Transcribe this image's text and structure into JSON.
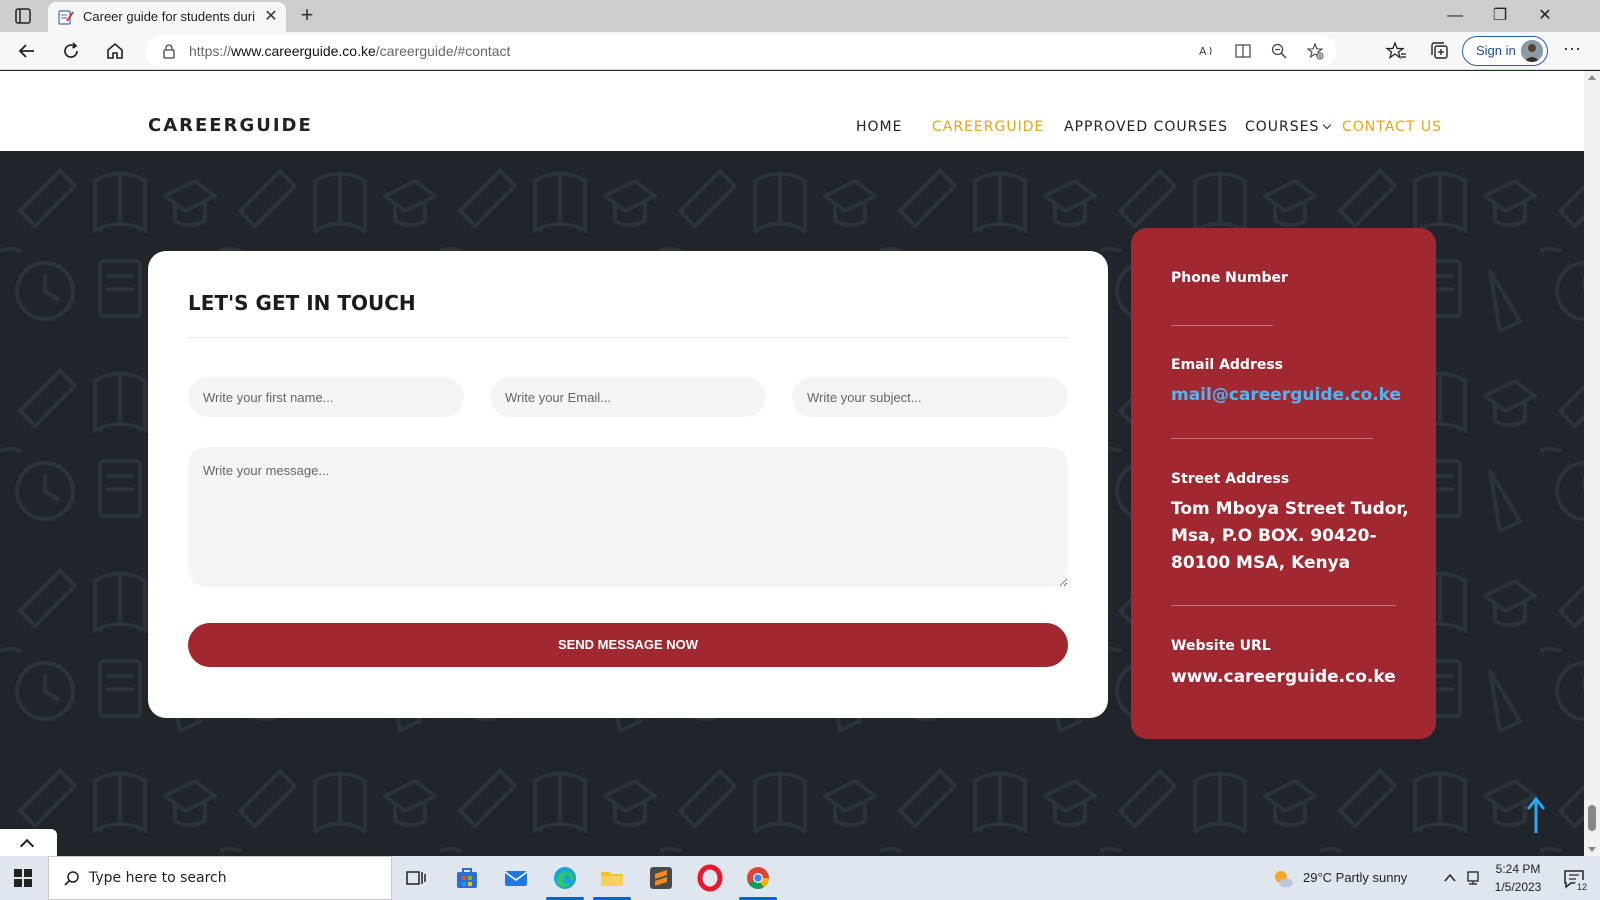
{
  "browser": {
    "tab_title": "Career guide for students during",
    "new_tab_symbol": "+",
    "tab_close_symbol": "✕",
    "url_prefix": "https://",
    "url_host": "www.careerguide.co.ke",
    "url_path": "/careerguide/#contact",
    "sign_in_label": "Sign in",
    "more_symbol": "⋯",
    "window_controls": {
      "minimize": "—",
      "maximize": "❐",
      "close": "✕"
    },
    "icons": [
      "tab-actions-icon",
      "back-icon",
      "refresh-icon",
      "home-icon",
      "lock-icon",
      "read-aloud-icon",
      "immersive-reader-icon",
      "zoom-icon",
      "add-favorite-icon",
      "favorites-icon",
      "collections-icon"
    ]
  },
  "site": {
    "logo": "CAREERGUIDE",
    "nav": [
      {
        "label": "HOME",
        "active": false
      },
      {
        "label": "CAREERGUIDE",
        "active": true
      },
      {
        "label": "APPROVED COURSES",
        "active": false
      },
      {
        "label": "COURSES",
        "active": false,
        "has_dropdown": true
      },
      {
        "label": "CONTACT US",
        "active": true
      }
    ],
    "accent_color": "#e8a317"
  },
  "contact_form": {
    "title": "LET'S GET IN TOUCH",
    "first_name_placeholder": "Write your first name...",
    "email_placeholder": "Write your Email...",
    "subject_placeholder": "Write your subject...",
    "message_placeholder": "Write your message...",
    "submit_label": "SEND MESSAGE NOW",
    "button_color": "#a12830"
  },
  "contact_info": {
    "phone_label": "Phone Number",
    "phone_value": "",
    "email_label": "Email Address",
    "email_value": "mail@careerguide.co.ke",
    "address_label": "Street Address",
    "address_lines": [
      "Tom Mboya Street Tudor,",
      "Msa, P.O BOX. 90420-",
      "80100 MSA, Kenya"
    ],
    "website_label": "Website URL",
    "website_value": "www.careerguide.co.ke",
    "card_color": "#a12830",
    "link_color": "#4fb6f5"
  },
  "taskbar": {
    "search_placeholder": "Type here to search",
    "weather": "29°C  Partly sunny",
    "time": "5:24 PM",
    "date": "1/5/2023",
    "notification_count": "12",
    "apps": [
      "task-view-icon",
      "store-icon",
      "mail-icon",
      "edge-icon",
      "file-explorer-icon",
      "sublime-icon",
      "opera-icon",
      "chrome-icon"
    ]
  }
}
